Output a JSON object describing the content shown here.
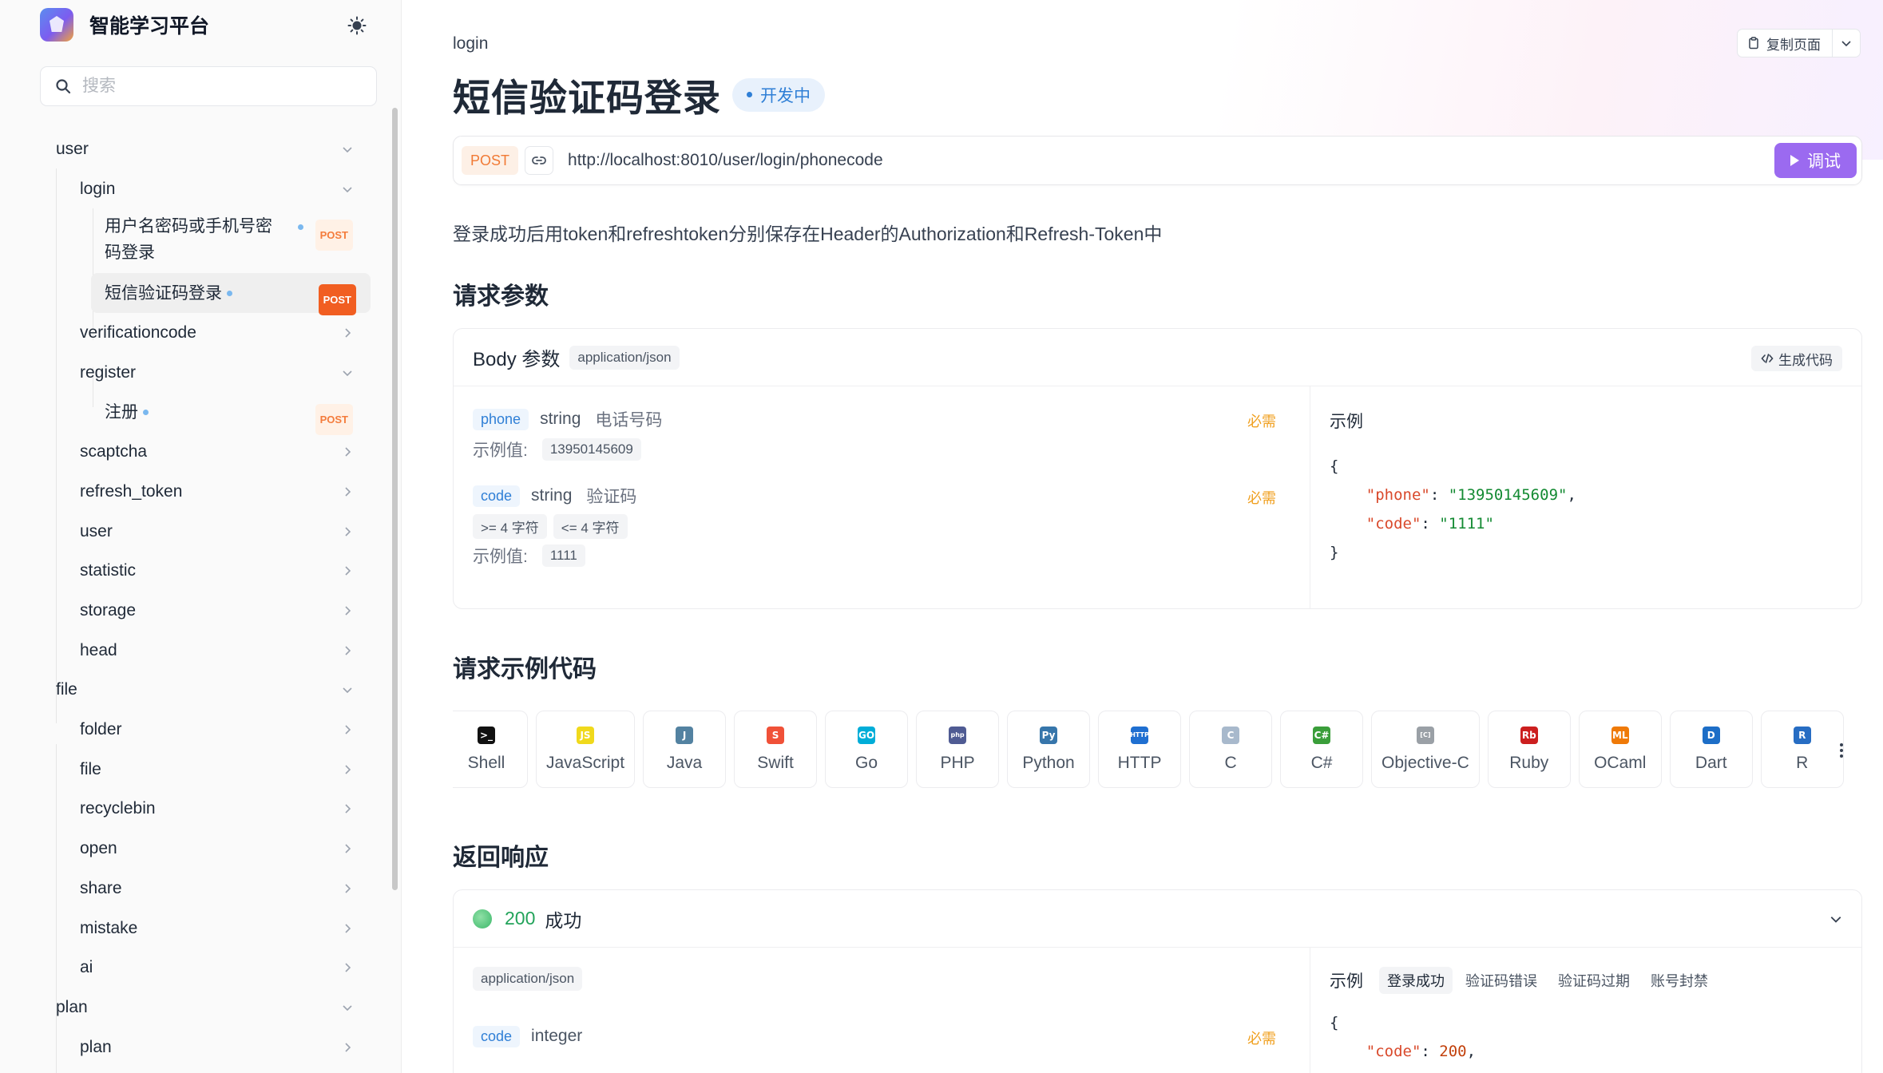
{
  "app": {
    "title": "智能学习平台"
  },
  "search": {
    "placeholder": "搜索"
  },
  "nav": {
    "user": "user",
    "login": "login",
    "login_pwd": "用户名密码或手机号密码登录",
    "login_pwd_method": "POST",
    "login_sms": "短信验证码登录",
    "login_sms_method": "POST",
    "verificationcode": "verificationcode",
    "register": "register",
    "register_item": "注册",
    "register_item_method": "POST",
    "scaptcha": "scaptcha",
    "refresh_token": "refresh_token",
    "user2": "user",
    "statistic": "statistic",
    "storage": "storage",
    "head": "head",
    "file": "file",
    "folder": "folder",
    "file2": "file",
    "recyclebin": "recyclebin",
    "open": "open",
    "share": "share",
    "mistake": "mistake",
    "ai": "ai",
    "plan": "plan",
    "plan2": "plan"
  },
  "page": {
    "breadcrumb": "login",
    "title": "短信验证码登录",
    "status": "开发中",
    "copy_label": "复制页面",
    "method": "POST",
    "url": "http://localhost:8010/user/login/phonecode",
    "try_label": "调试",
    "description": "登录成功后用token和refreshtoken分别保存在Header的Authorization和Refresh-Token中"
  },
  "request": {
    "heading": "请求参数",
    "body_title": "Body 参数",
    "content_type": "application/json",
    "gen_code_label": "生成代码",
    "example_title": "示例",
    "example_label": "示例值:",
    "required_label": "必需",
    "params": [
      {
        "name": "phone",
        "type": "string",
        "desc": "电话号码",
        "example": "13950145609"
      },
      {
        "name": "code",
        "type": "string",
        "desc": "验证码",
        "min": ">= 4 字符",
        "max": "<= 4 字符",
        "example": "1111"
      }
    ],
    "json_example": {
      "open": "{",
      "k1": "\"phone\"",
      "v1": "\"13950145609\"",
      "k2": "\"code\"",
      "v2": "\"1111\"",
      "close": "}"
    }
  },
  "code_samples": {
    "heading": "请求示例代码",
    "languages": [
      {
        "name": "Shell",
        "icon": "shell-icon",
        "color": "#111111",
        "glyph": ">_"
      },
      {
        "name": "JavaScript",
        "icon": "javascript-icon",
        "color": "#f0d91c",
        "glyph": "JS"
      },
      {
        "name": "Java",
        "icon": "java-icon",
        "color": "#5382a1",
        "glyph": "J"
      },
      {
        "name": "Swift",
        "icon": "swift-icon",
        "color": "#f05138",
        "glyph": "S"
      },
      {
        "name": "Go",
        "icon": "go-icon",
        "color": "#00add8",
        "glyph": "GO"
      },
      {
        "name": "PHP",
        "icon": "php-icon",
        "color": "#4f5b93",
        "glyph": "php"
      },
      {
        "name": "Python",
        "icon": "python-icon",
        "color": "#3776ab",
        "glyph": "Py"
      },
      {
        "name": "HTTP",
        "icon": "http-icon",
        "color": "#1f6fd1",
        "glyph": "HTTP"
      },
      {
        "name": "C",
        "icon": "c-icon",
        "color": "#a8b9cc",
        "glyph": "C"
      },
      {
        "name": "C#",
        "icon": "csharp-icon",
        "color": "#3a9e3a",
        "glyph": "C#"
      },
      {
        "name": "Objective-C",
        "icon": "objective-c-icon",
        "color": "#9aa0a6",
        "glyph": "[C]"
      },
      {
        "name": "Ruby",
        "icon": "ruby-icon",
        "color": "#cc1f1f",
        "glyph": "Rb"
      },
      {
        "name": "OCaml",
        "icon": "ocaml-icon",
        "color": "#ef7a08",
        "glyph": "ML"
      },
      {
        "name": "Dart",
        "icon": "dart-icon",
        "color": "#1d6ec7",
        "glyph": "D"
      },
      {
        "name": "R",
        "icon": "r-icon",
        "color": "#276dc3",
        "glyph": "R"
      }
    ]
  },
  "response": {
    "heading": "返回响应",
    "status_code": "200",
    "status_text": "成功",
    "content_type": "application/json",
    "example_title": "示例",
    "tabs": [
      "登录成功",
      "验证码错误",
      "验证码过期",
      "账号封禁"
    ],
    "param_name": "code",
    "param_type": "integer",
    "required_label": "必需",
    "json_open": "{",
    "json_k1": "\"code\"",
    "json_v1": "200"
  },
  "colors": {
    "accent": "#9b6af0",
    "post": "#f15e21",
    "status_ok": "#22a35a",
    "badge_blue": "#2f7fd6"
  }
}
